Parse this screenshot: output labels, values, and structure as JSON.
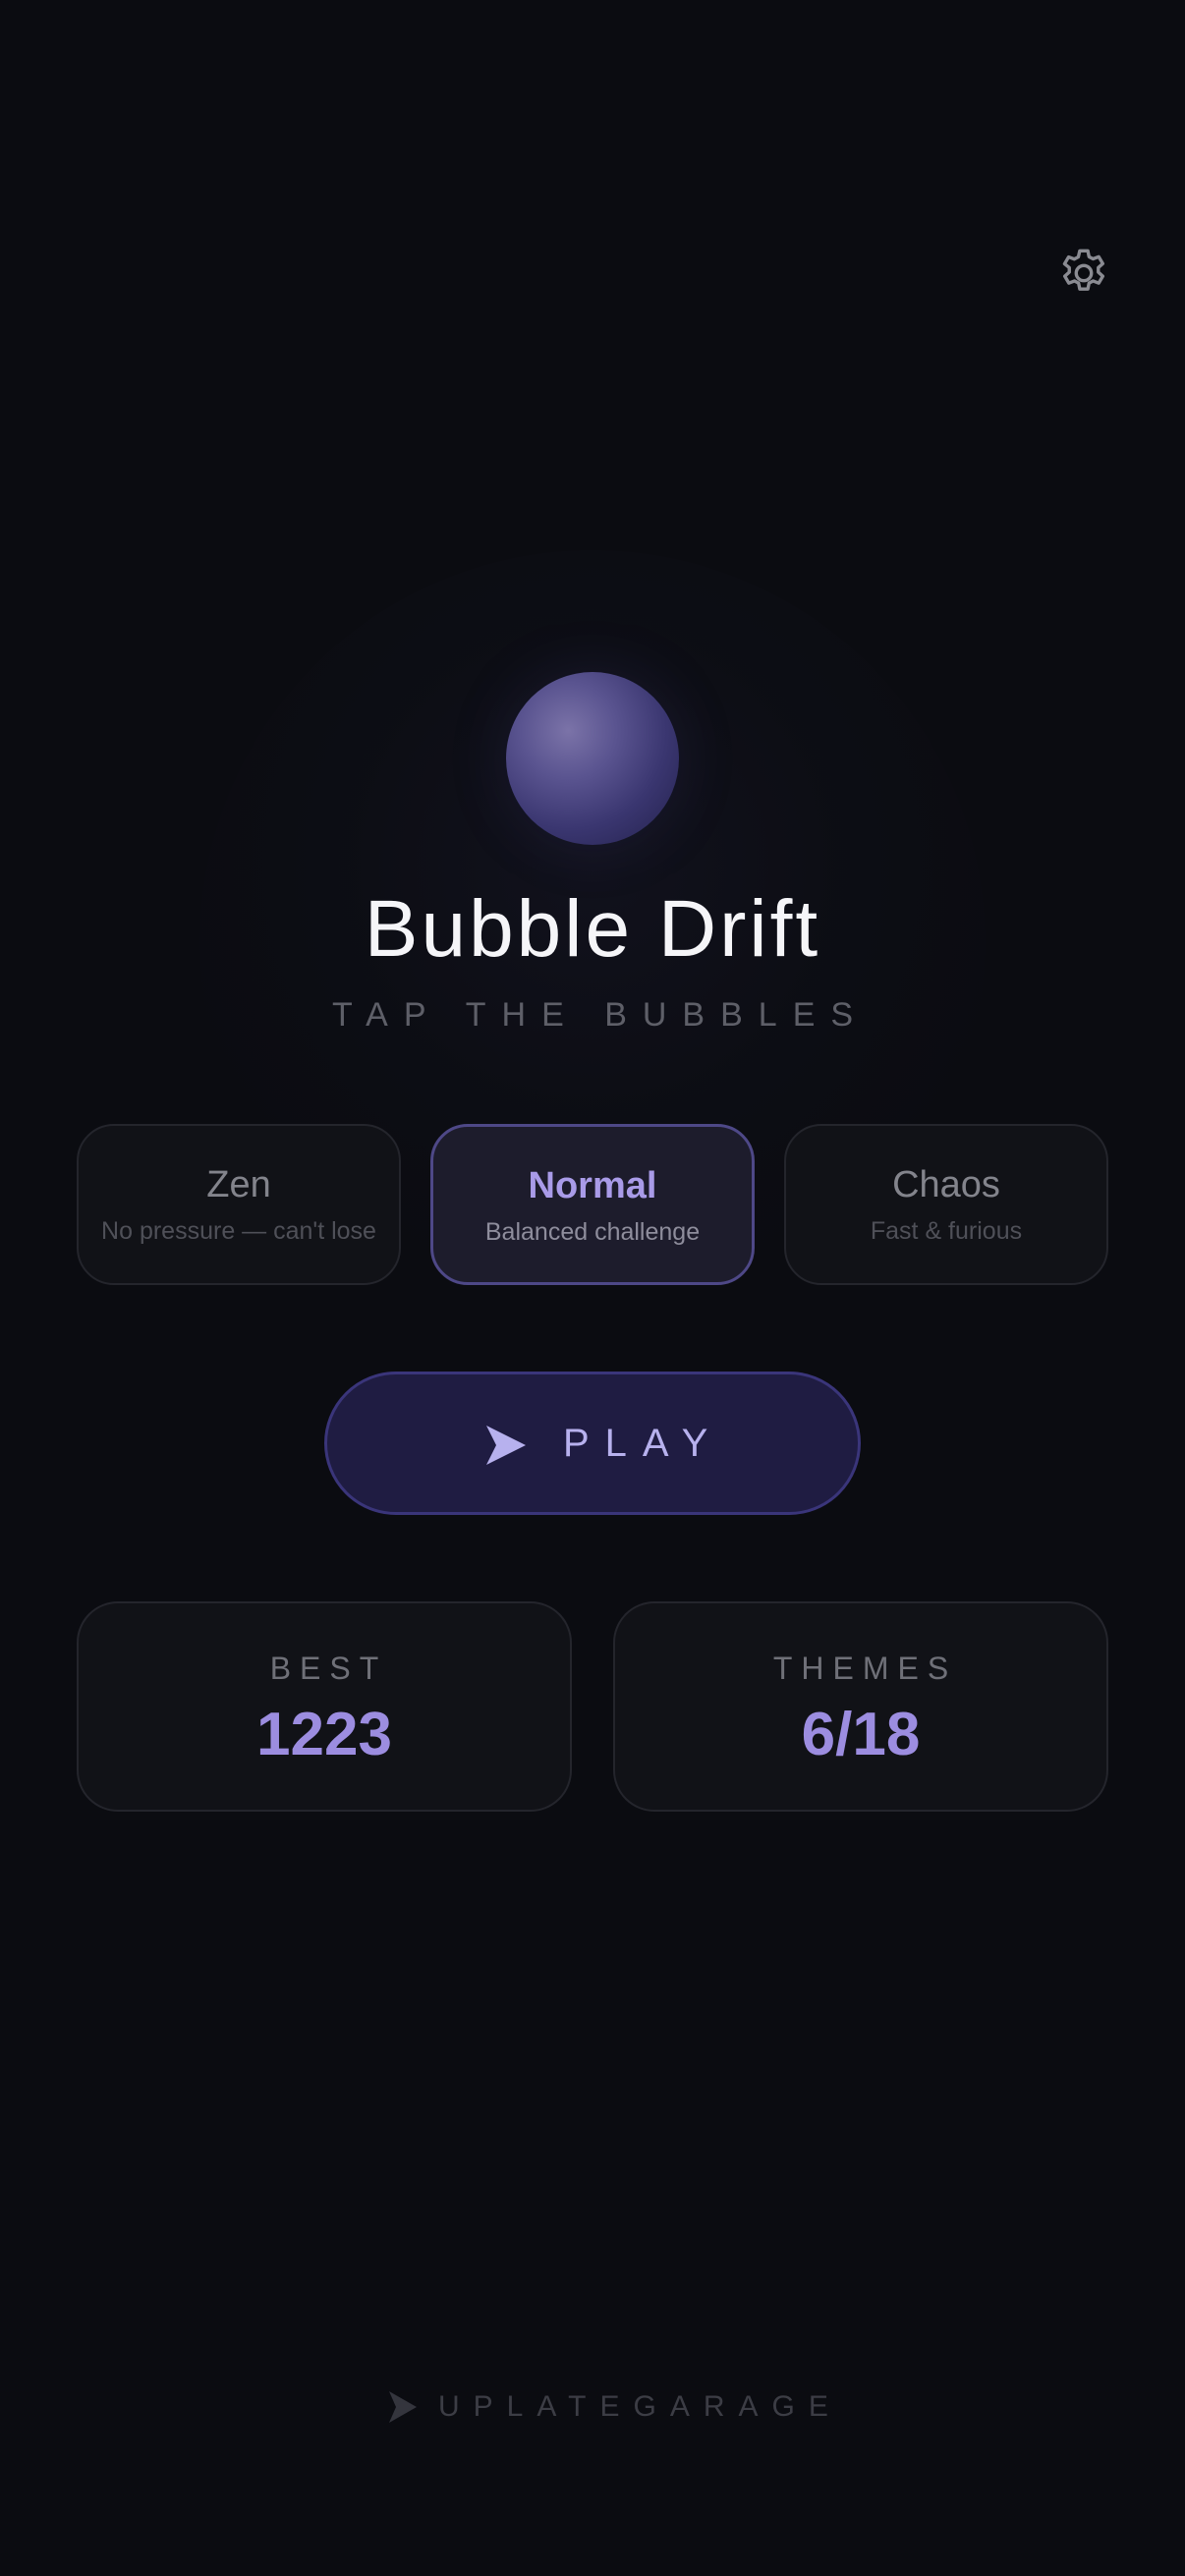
{
  "app": {
    "title": "Bubble Drift",
    "subtitle": "TAP THE BUBBLES"
  },
  "settings": {
    "icon": "gear-icon"
  },
  "modes": [
    {
      "name": "Zen",
      "description": "No pressure — can't lose",
      "selected": false
    },
    {
      "name": "Normal",
      "description": "Balanced challenge",
      "selected": true
    },
    {
      "name": "Chaos",
      "description": "Fast & furious",
      "selected": false
    }
  ],
  "play": {
    "label": "PLAY",
    "icon": "play-icon"
  },
  "stats": {
    "best": {
      "label": "BEST",
      "value": "1223"
    },
    "themes": {
      "label": "THEMES",
      "value": "6/18"
    }
  },
  "footer": {
    "brand": "UPLATEGARAGE",
    "icon": "play-icon"
  },
  "colors": {
    "background": "#0b0c11",
    "accent": "#a99be8",
    "play_button": "#1f1c42",
    "card": "#111217"
  }
}
